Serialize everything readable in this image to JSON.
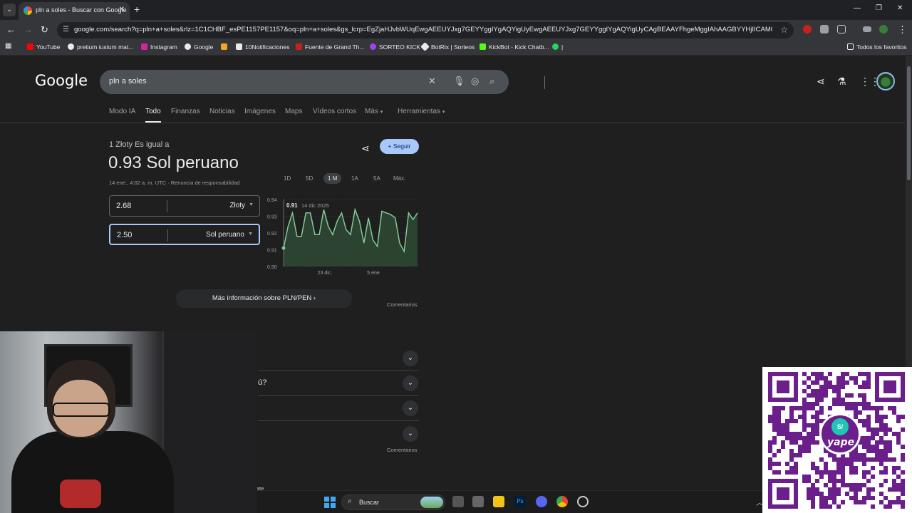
{
  "browser": {
    "tab_title": "pln a soles - Buscar con Google",
    "url": "google.com/search?q=pln+a+soles&rlz=1C1CHBF_esPE1157PE1157&oq=pln+a+soles&gs_lcrp=EgZjaHJvbWUqEwgAEEUYJxg7GEYYggIYgAQYigUyEwgAEEUYJxg7GEYYggIYgAQYigUyCAgBEAAYFhgeMggIAhAAGBYYHjIICAMQABgWGB4yC...",
    "bookmarks": [
      "YouTube",
      "pretium iustum mat...",
      "Instagram",
      "Google",
      "",
      "10Notificaciones",
      "Fuente de Grand Th...",
      "SORTEO KICK",
      "BotRix | Sorteos",
      "KickBot - Kick Chatb...",
      "|"
    ],
    "bookmarks_folder": "Todos los favoritos"
  },
  "search": {
    "logo": "Google",
    "query": "pln a soles",
    "tabs": [
      "Modo IA",
      "Todo",
      "Finanzas",
      "Noticias",
      "Imágenes",
      "Maps",
      "Vídeos cortos",
      "Más",
      "Herramientas"
    ],
    "active_tab": "Todo"
  },
  "converter": {
    "subtitle": "1 Złoty Es igual a",
    "result": "0.93 Sol peruano",
    "meta": "14 ene., 4:02 a. m. UTC · Renuncia de responsabilidad",
    "follow_label": "Seguir",
    "from_value": "2.68",
    "from_unit": "Złoty",
    "to_value": "2.50",
    "to_unit": "Sol peruano",
    "ranges": [
      "1D",
      "5D",
      "1 M",
      "1A",
      "5A",
      "Máx."
    ],
    "active_range": "1 M",
    "more_info": "Más información sobre PLN/PEN",
    "comments": "Comentarios"
  },
  "chart_data": {
    "type": "line",
    "yticks": [
      "0.94",
      "0.93",
      "0.92",
      "0.91",
      "0.90"
    ],
    "ylim": [
      0.9,
      0.94
    ],
    "xticks": [
      "23 dic.",
      "5 ene."
    ],
    "tooltip_value": "0.91",
    "tooltip_date": "14 dic 2025",
    "color": "#81c995",
    "values": [
      0.911,
      0.924,
      0.932,
      0.918,
      0.918,
      0.932,
      0.932,
      0.919,
      0.919,
      0.934,
      0.924,
      0.919,
      0.927,
      0.932,
      0.922,
      0.919,
      0.934,
      0.927,
      0.914,
      0.929,
      0.916,
      0.912,
      0.933,
      0.932,
      0.931,
      0.929,
      0.914,
      0.909,
      0.932,
      0.928,
      0.932
    ]
  },
  "faq": {
    "questions": [
      "",
      "ú?",
      "",
      ""
    ],
    "comments": "Comentarios",
    "footer_fragment": "ate"
  },
  "qr": {
    "brand": "yape",
    "badge": "S/",
    "color": "#6b1f8a"
  },
  "taskbar": {
    "search_label": "Buscar"
  }
}
